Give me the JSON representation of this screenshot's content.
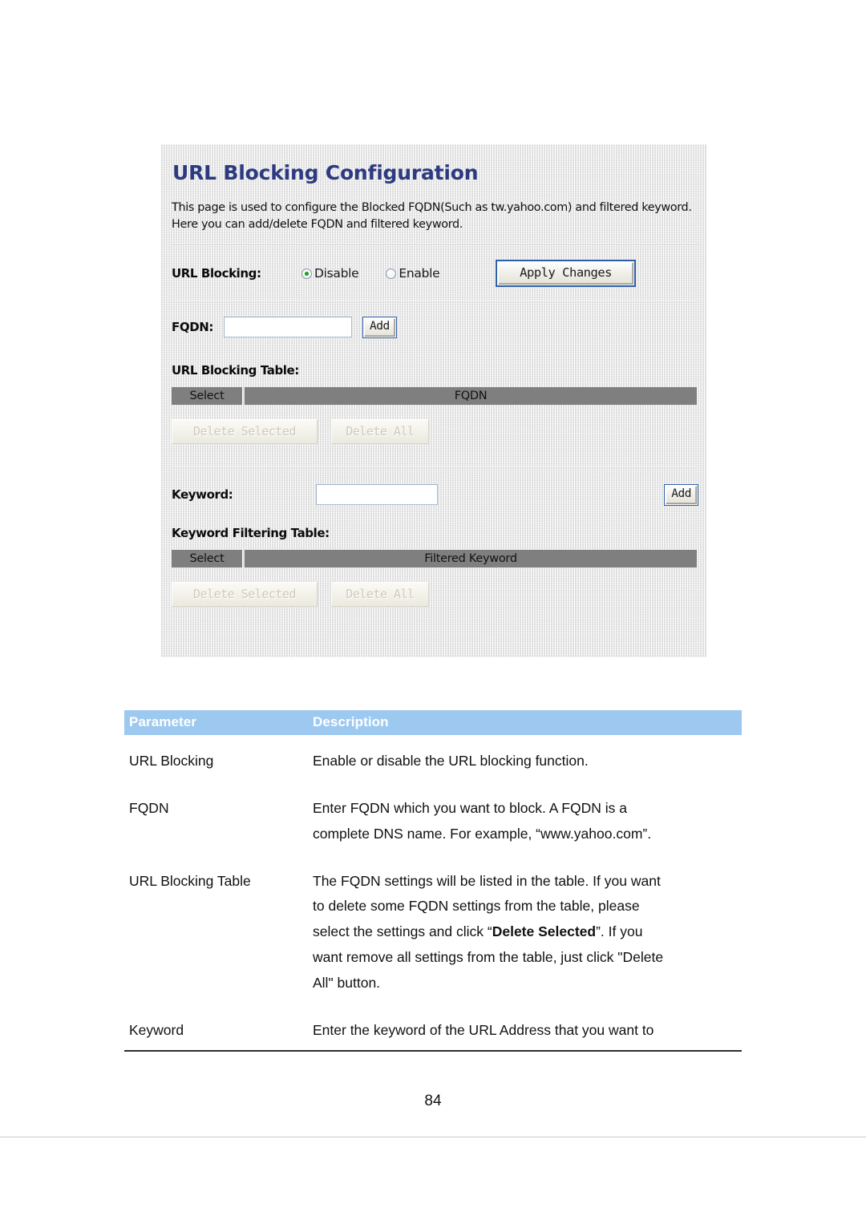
{
  "router_ui": {
    "title": "URL Blocking Configuration",
    "description": "This page is used to configure the Blocked FQDN(Such as tw.yahoo.com) and filtered keyword. Here you can add/delete FQDN and filtered keyword.",
    "url_blocking": {
      "label": "URL Blocking:",
      "options": [
        {
          "label": "Disable",
          "checked": true
        },
        {
          "label": "Enable",
          "checked": false
        }
      ],
      "apply_button": "Apply Changes"
    },
    "fqdn": {
      "label": "FQDN:",
      "value": "",
      "add_button": "Add"
    },
    "url_blocking_table": {
      "label": "URL Blocking Table:",
      "columns": [
        "Select",
        "FQDN"
      ],
      "rows": [],
      "delete_selected_button": "Delete Selected",
      "delete_all_button": "Delete All"
    },
    "keyword": {
      "label": "Keyword:",
      "value": "",
      "add_button": "Add"
    },
    "keyword_filtering_table": {
      "label": "Keyword Filtering Table:",
      "columns": [
        "Select",
        "Filtered Keyword"
      ],
      "rows": [],
      "delete_selected_button": "Delete Selected",
      "delete_all_button": "Delete All"
    }
  },
  "param_table": {
    "headers": {
      "parameter": "Parameter",
      "description": "Description"
    },
    "rows": [
      {
        "parameter": "URL Blocking",
        "description": "Enable or disable the URL blocking function."
      },
      {
        "parameter": "FQDN",
        "description_line1": "Enter FQDN which you want to block. A FQDN is a",
        "description_line2": "complete DNS name. For example, “www.yahoo.com”."
      },
      {
        "parameter": "URL Blocking Table",
        "description_line1": "The FQDN settings will be listed in the table. If you want",
        "description_line2": "to delete some FQDN settings from the table, please",
        "description_line3_a": "select the settings and click “",
        "description_line3_bold": "Delete Selected",
        "description_line3_b": "”. If you",
        "description_line4": "want remove all settings from the table, just click \"Delete",
        "description_line5": "All\" button."
      },
      {
        "parameter": "Keyword",
        "description": "Enter the keyword of the URL Address that you want to"
      }
    ]
  },
  "page": {
    "number": "84"
  },
  "colors": {
    "title_blue": "#2c3a80",
    "table_header_blue": "#9dc9f0",
    "grey_header": "#7f7f7f",
    "radio_selected_green": "#18a018"
  }
}
